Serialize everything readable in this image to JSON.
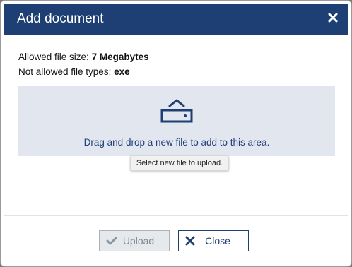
{
  "dialog": {
    "title": "Add document",
    "close_icon": "close-icon"
  },
  "info": {
    "allowed_size_label": "Allowed file size:",
    "allowed_size_value": "7 Megabytes",
    "not_allowed_label": "Not allowed file types:",
    "not_allowed_value": "exe"
  },
  "dropzone": {
    "icon": "upload-tray-icon",
    "text": "Drag and drop a new file to add to this area.",
    "tooltip": "Select new file to upload."
  },
  "buttons": {
    "upload_label": "Upload",
    "upload_icon": "checkmark-icon",
    "close_label": "Close",
    "close_icon": "x-icon"
  },
  "colors": {
    "header": "#1e3f73",
    "dropzone_bg": "#e2e7ef",
    "accent_text": "#24407a"
  }
}
